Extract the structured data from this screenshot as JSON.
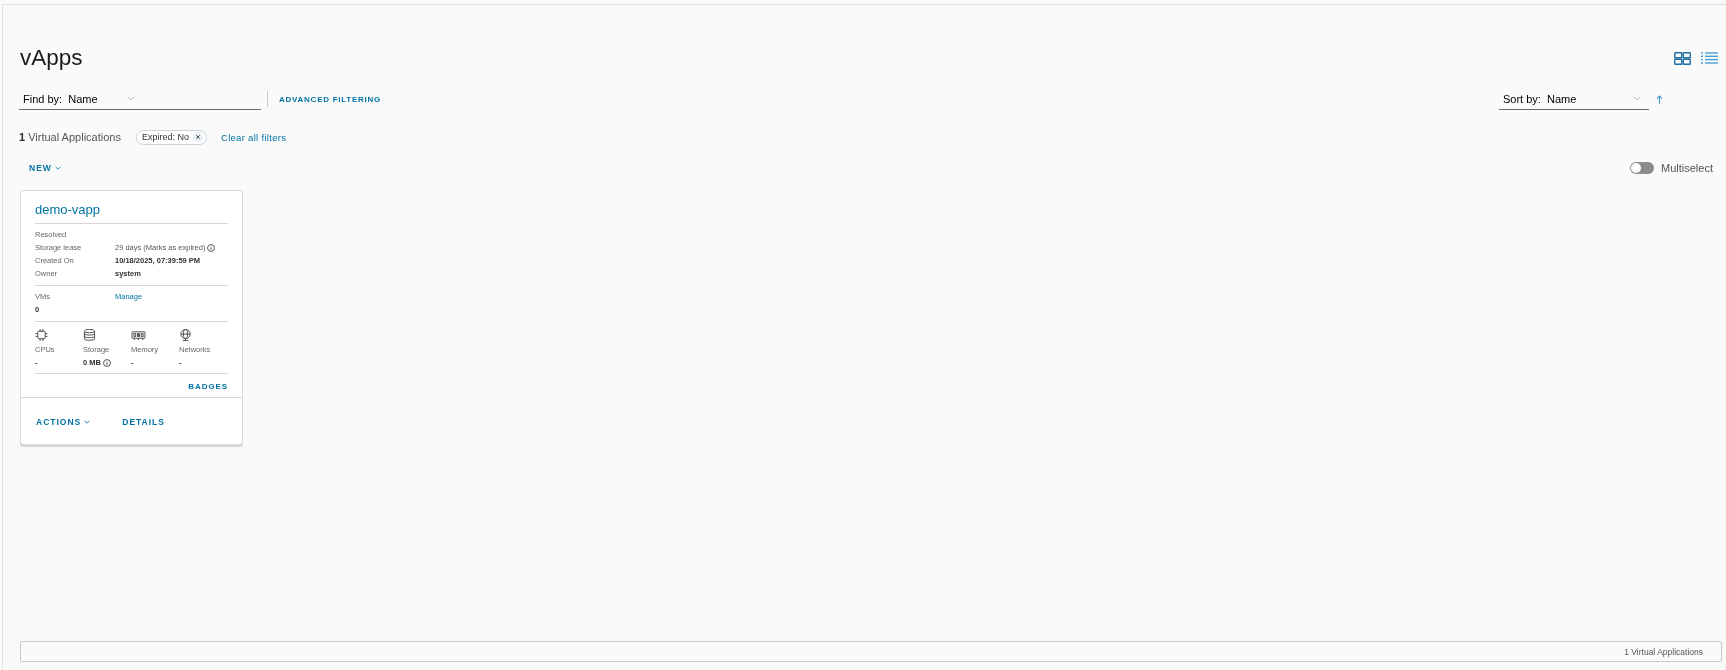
{
  "page": {
    "title": "vApps"
  },
  "view_modes": [
    {
      "kind": "grid",
      "selected": true
    },
    {
      "kind": "list",
      "selected": false
    }
  ],
  "find": {
    "label": "Find by:",
    "value": "Name"
  },
  "advanced_filtering": "ADVANCED FILTERING",
  "sort": {
    "label": "Sort by:",
    "value": "Name",
    "ascending": true
  },
  "summary": "**1** Virtual Applications",
  "filter_chips": [
    {
      "label": "Expired: No"
    }
  ],
  "clear_filters": "Clear all filters",
  "new_button": "NEW",
  "multiselect": {
    "label": "Multiselect",
    "on": false
  },
  "cards": [
    {
      "title": "demo-vapp",
      "status": "Resolved",
      "details": [
        {
          "label": "Storage lease",
          "value": "29 days (Marks as expired)",
          "emphasis": false,
          "info": true
        },
        {
          "label": "Created On",
          "value": "10/18/2025, 07:39:59 PM",
          "emphasis": true,
          "info": false
        },
        {
          "label": "Owner",
          "value": "system",
          "emphasis": true,
          "info": false
        }
      ],
      "vms": {
        "label": "VMs",
        "count": "0",
        "link": "Manage"
      },
      "resources": [
        {
          "kind": "cpu",
          "label": "CPUs",
          "value": "-",
          "info": false
        },
        {
          "kind": "storage",
          "label": "Storage",
          "value": "0 MB",
          "info": true
        },
        {
          "kind": "memory",
          "label": "Memory",
          "value": "-",
          "info": false
        },
        {
          "kind": "network",
          "label": "Networks",
          "value": "-",
          "info": false
        }
      ],
      "badges": "BADGES",
      "actions": [
        {
          "label": "ACTIONS",
          "kind": "menu"
        },
        {
          "label": "DETAILS",
          "kind": "link"
        }
      ]
    }
  ],
  "footer": {
    "text": "1 Virtual Applications"
  }
}
